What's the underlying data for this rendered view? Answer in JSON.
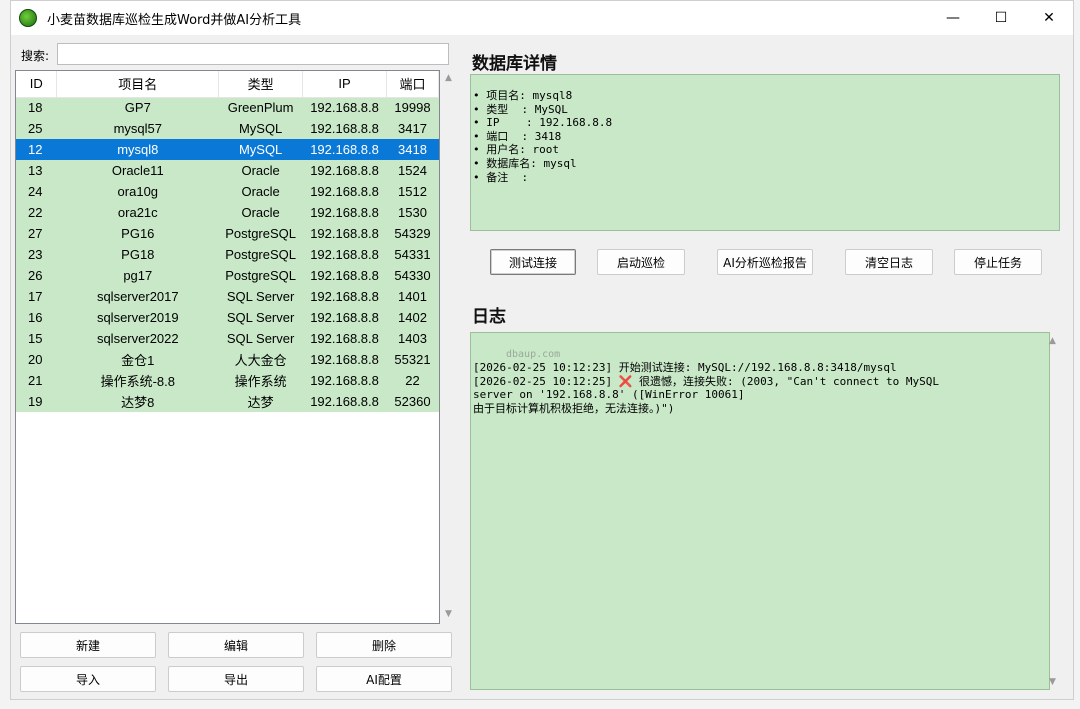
{
  "window": {
    "title": "小麦苗数据库巡检生成Word并做AI分析工具",
    "controls": {
      "minimize": "—",
      "maximize": "☐",
      "close": "✕"
    }
  },
  "search": {
    "label": "搜索:",
    "value": ""
  },
  "table": {
    "headers": {
      "id": "ID",
      "name": "项目名",
      "type": "类型",
      "ip": "IP",
      "port": "端口"
    },
    "rows": [
      {
        "id": "18",
        "name": "GP7",
        "type": "GreenPlum",
        "ip": "192.168.8.8",
        "port": "19998"
      },
      {
        "id": "25",
        "name": "mysql57",
        "type": "MySQL",
        "ip": "192.168.8.8",
        "port": "3417"
      },
      {
        "id": "12",
        "name": "mysql8",
        "type": "MySQL",
        "ip": "192.168.8.8",
        "port": "3418"
      },
      {
        "id": "13",
        "name": "Oracle11",
        "type": "Oracle",
        "ip": "192.168.8.8",
        "port": "1524"
      },
      {
        "id": "24",
        "name": "ora10g",
        "type": "Oracle",
        "ip": "192.168.8.8",
        "port": "1512"
      },
      {
        "id": "22",
        "name": "ora21c",
        "type": "Oracle",
        "ip": "192.168.8.8",
        "port": "1530"
      },
      {
        "id": "27",
        "name": "PG16",
        "type": "PostgreSQL",
        "ip": "192.168.8.8",
        "port": "54329"
      },
      {
        "id": "23",
        "name": "PG18",
        "type": "PostgreSQL",
        "ip": "192.168.8.8",
        "port": "54331"
      },
      {
        "id": "26",
        "name": "pg17",
        "type": "PostgreSQL",
        "ip": "192.168.8.8",
        "port": "54330"
      },
      {
        "id": "17",
        "name": "sqlserver2017",
        "type": "SQL Server",
        "ip": "192.168.8.8",
        "port": "1401"
      },
      {
        "id": "16",
        "name": "sqlserver2019",
        "type": "SQL Server",
        "ip": "192.168.8.8",
        "port": "1402"
      },
      {
        "id": "15",
        "name": "sqlserver2022",
        "type": "SQL Server",
        "ip": "192.168.8.8",
        "port": "1403"
      },
      {
        "id": "20",
        "name": "金仓1",
        "type": "人大金仓",
        "ip": "192.168.8.8",
        "port": "55321"
      },
      {
        "id": "21",
        "name": "操作系统-8.8",
        "type": "操作系统",
        "ip": "192.168.8.8",
        "port": "22"
      },
      {
        "id": "19",
        "name": "达梦8",
        "type": "达梦",
        "ip": "192.168.8.8",
        "port": "52360"
      }
    ],
    "selected_id": "12"
  },
  "left_buttons": {
    "new": "新建",
    "edit": "编辑",
    "delete": "删除",
    "import": "导入",
    "export": "导出",
    "ai_config": "AI配置"
  },
  "details": {
    "title": "数据库详情",
    "lines": [
      "• 项目名: mysql8",
      "• 类型  : MySQL",
      "• IP    : 192.168.8.8",
      "• 端口  : 3418",
      "• 用户名: root",
      "• 数据库名: mysql",
      "• 备注  :"
    ]
  },
  "actions": {
    "test_connection": "测试连接",
    "start_inspection": "启动巡检",
    "ai_report": "AI分析巡检报告",
    "clear_log": "清空日志",
    "stop_task": "停止任务"
  },
  "log": {
    "title": "日志",
    "watermark": "dbaup.com",
    "lines": [
      "[2026-02-25 10:12:23] 开始测试连接: MySQL://192.168.8.8:3418/mysql",
      "[2026-02-25 10:12:25] ❌ 很遗憾，连接失败: (2003, \"Can't connect to MySQL",
      "server on '192.168.8.8' ([WinError 10061]",
      "由于目标计算机积极拒绝，无法连接。)\")"
    ]
  },
  "colors": {
    "row_bg": "#c8e8c8",
    "selected_bg": "#0a78d7",
    "panel_bg": "#c8e8c8"
  }
}
